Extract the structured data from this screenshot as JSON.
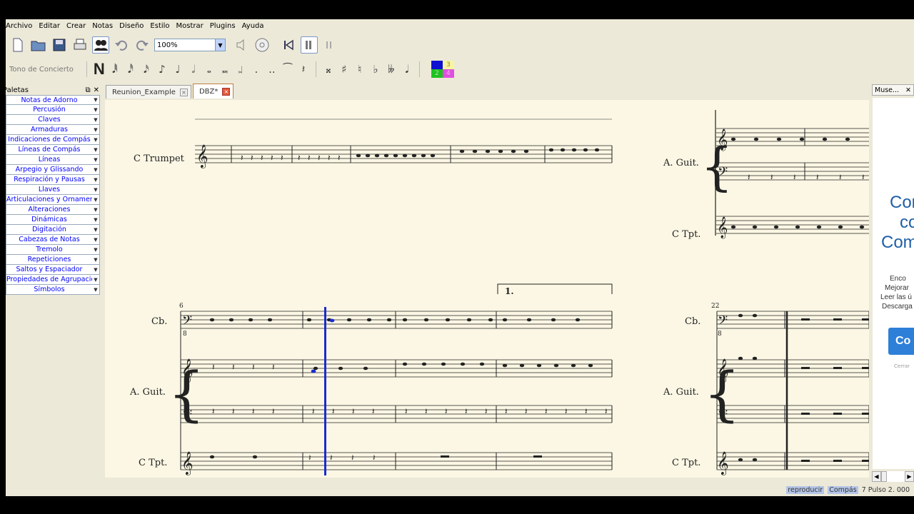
{
  "menu": [
    "Archivo",
    "Editar",
    "Crear",
    "Notas",
    "Diseño",
    "Estilo",
    "Mostrar",
    "Plugins",
    "Ayuda"
  ],
  "toolbar": {
    "zoom_value": "100%"
  },
  "note_toolbar": {
    "concert_pitch_label": "Tono de Concierto",
    "input_mode_label": "N",
    "voices": [
      "1",
      "3",
      "2",
      "4"
    ],
    "voice_colors": [
      "#1010d0",
      "#f5f5a0",
      "#20c020",
      "#e050e0"
    ]
  },
  "palette": {
    "title": "Paletas",
    "items": [
      "Notas de Adorno",
      "Percusión",
      "Claves",
      "Armaduras",
      "Indicaciones de Compás",
      "Líneas de Compás",
      "Líneas",
      "Arpegio y Glissando",
      "Respiración y Pausas",
      "Llaves",
      "Articulaciones y Ornamentos",
      "Alteraciones",
      "Dinámicas",
      "Digitación",
      "Cabezas de Notas",
      "Tremolo",
      "Repeticiones",
      "Saltos y Espaciador",
      "Propiedades de Agrupación",
      "Símbolos"
    ]
  },
  "tabs": [
    {
      "label": "Reunion_Example",
      "active": false
    },
    {
      "label": "DBZ*",
      "active": true
    }
  ],
  "score": {
    "system1_left": [
      "C Trumpet"
    ],
    "system1_right": [
      "A. Guit.",
      "C Tpt."
    ],
    "system2_left": [
      "Cb.",
      "A. Guit.",
      "C Tpt."
    ],
    "system2_right": [
      "Cb.",
      "A. Guit.",
      "C Tpt."
    ],
    "measure_number_left": "6",
    "measure_number_right": "22",
    "volta_label": "1.",
    "octave_marker": "8"
  },
  "side_panel": {
    "title": "Muse...",
    "headline": [
      "Cor",
      "co",
      "Com"
    ],
    "body": [
      "Enco",
      "Mejorar",
      "Leer las ú",
      "Descarga"
    ],
    "button": "Co",
    "close_text": "Cerrar"
  },
  "status": {
    "mode": "reproducir",
    "measure_label": "Compás",
    "position": "7 Pulso  2. 000"
  }
}
